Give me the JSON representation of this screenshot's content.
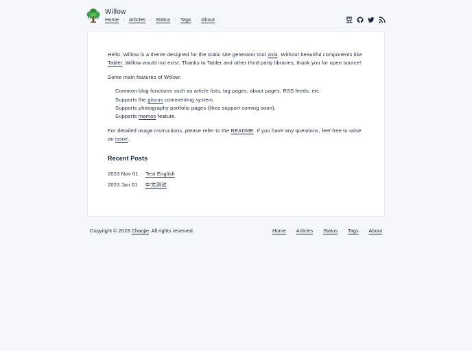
{
  "site": {
    "title": "Willow"
  },
  "nav": {
    "home": "Home",
    "articles": "Articles",
    "status": "Status",
    "tags": "Tags",
    "about": "About",
    "separator": "·"
  },
  "social": [
    "douban-icon",
    "github-icon",
    "twitter-icon",
    "rss-icon"
  ],
  "intro": {
    "part1": "Hello, Willow is a theme designed for the static site generator tool ",
    "link1": "zola",
    "part2": ". Without beautiful components like ",
    "link2": "Tabler",
    "part3": ", Willow would not exist. Thanks to Tabler and other third-party libraries, thank you for open source!"
  },
  "features_title": "Some main features of Willow:",
  "features": {
    "f1": "Common blog functions such as article lists, tag pages, about pages, RSS feeds, etc.",
    "f2_pre": "Supports the ",
    "f2_link": "giscus",
    "f2_post": " commenting system.",
    "f3": "Supports photography portfolio pages (likes support coming soon).",
    "f4_pre": "Supports ",
    "f4_link": "memos",
    "f4_post": " feature."
  },
  "usage": {
    "pre": "For detailed usage instructions, please refer to the ",
    "link1": "README",
    "mid": ". If you have any questions, feel free to raise an ",
    "link2": "issue",
    "post": "."
  },
  "recent": {
    "title": "Recent Posts",
    "posts": [
      {
        "date": "2023 Nov 01",
        "title": "Test English"
      },
      {
        "date": "2023 Jan 01",
        "title": "中文测试"
      }
    ]
  },
  "footer": {
    "copy_pre": "Copyright © 2023 ",
    "author": "Chaojie",
    "copy_post": ". All rights reserved."
  },
  "colors": {
    "background": "#f5f7fb",
    "card": "#ffffff",
    "text": "#1d273b",
    "logo_green": "#2f8a3a"
  }
}
